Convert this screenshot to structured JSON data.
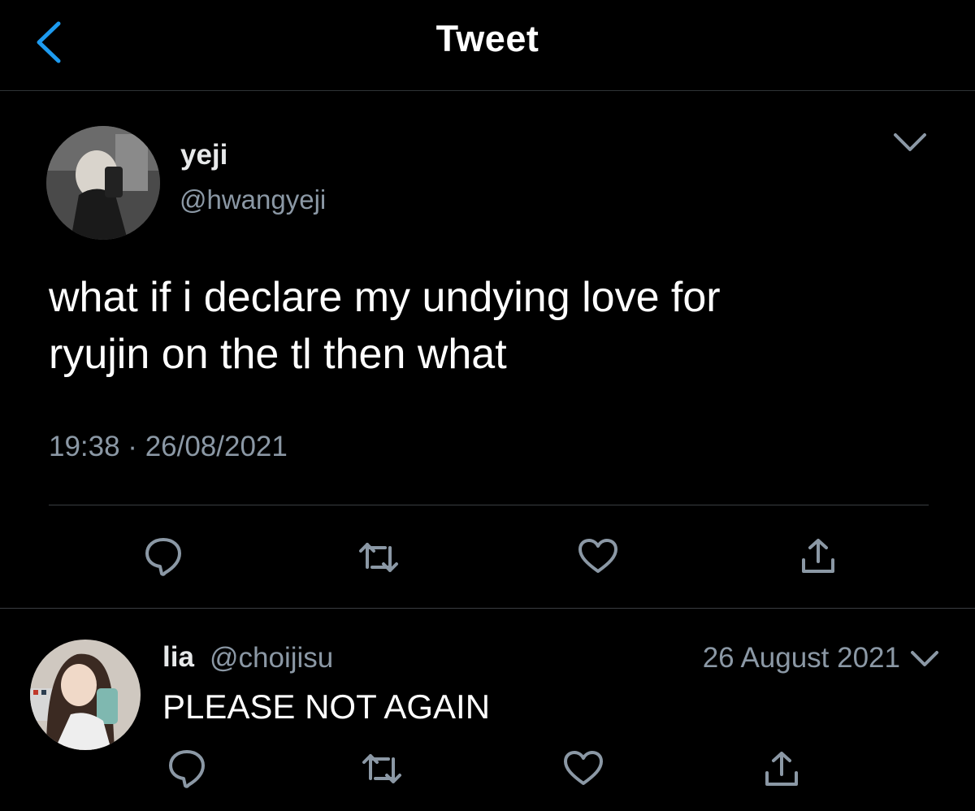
{
  "header": {
    "title": "Tweet",
    "back_icon": "chevron-left-icon",
    "accent_color": "#1d9bf0"
  },
  "main_tweet": {
    "display_name": "yeji",
    "handle": "@hwangyeji",
    "text_line1": "what if i declare my undying love for",
    "text_line2": "ryujin on the tl then what",
    "timestamp": "19:38 · 26/08/2021",
    "menu_icon": "chevron-down-icon",
    "actions": [
      "reply-icon",
      "retweet-icon",
      "like-icon",
      "share-icon"
    ]
  },
  "reply": {
    "display_name": "lia",
    "handle": "@choijisu",
    "date": "26 August 2021",
    "text": "PLEASE NOT AGAIN",
    "menu_icon": "chevron-down-icon",
    "actions": [
      "reply-icon",
      "retweet-icon",
      "like-icon",
      "share-icon"
    ]
  },
  "colors": {
    "background": "#000000",
    "primary_text": "#ffffff",
    "secondary_text": "#8b98a5",
    "divider": "#3a3d41"
  }
}
